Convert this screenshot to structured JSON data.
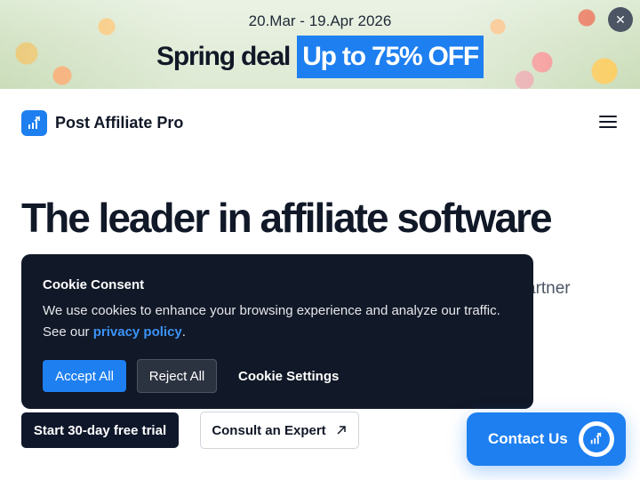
{
  "banner": {
    "dates": "20.Mar - 19.Apr 2026",
    "deal": "Spring deal",
    "offer": "Up to 75% OFF",
    "close_icon": "close-icon"
  },
  "header": {
    "brand": "Post Affiliate Pro",
    "logo_icon": "chart-arrow-icon",
    "menu_icon": "hamburger-icon"
  },
  "hero": {
    "title": "The leader in affiliate software",
    "subtitle_visible_tail": "artner",
    "cta_trial": "Start 30-day free trial",
    "cta_expert": "Consult an Expert",
    "cta_expert_icon": "arrow-up-right-icon"
  },
  "cookie": {
    "title": "Cookie Consent",
    "text_line1": "We use cookies to enhance your browsing experience and analyze our traffic.",
    "text_prefix": "See our",
    "policy_link": "privacy policy",
    "text_suffix": ".",
    "accept": "Accept All",
    "reject": "Reject All",
    "settings": "Cookie Settings"
  },
  "contact": {
    "label": "Contact Us",
    "icon": "chart-arrow-icon"
  },
  "colors": {
    "brand_blue": "#1d7ff0",
    "dark": "#111827",
    "link": "#3b93f7"
  }
}
